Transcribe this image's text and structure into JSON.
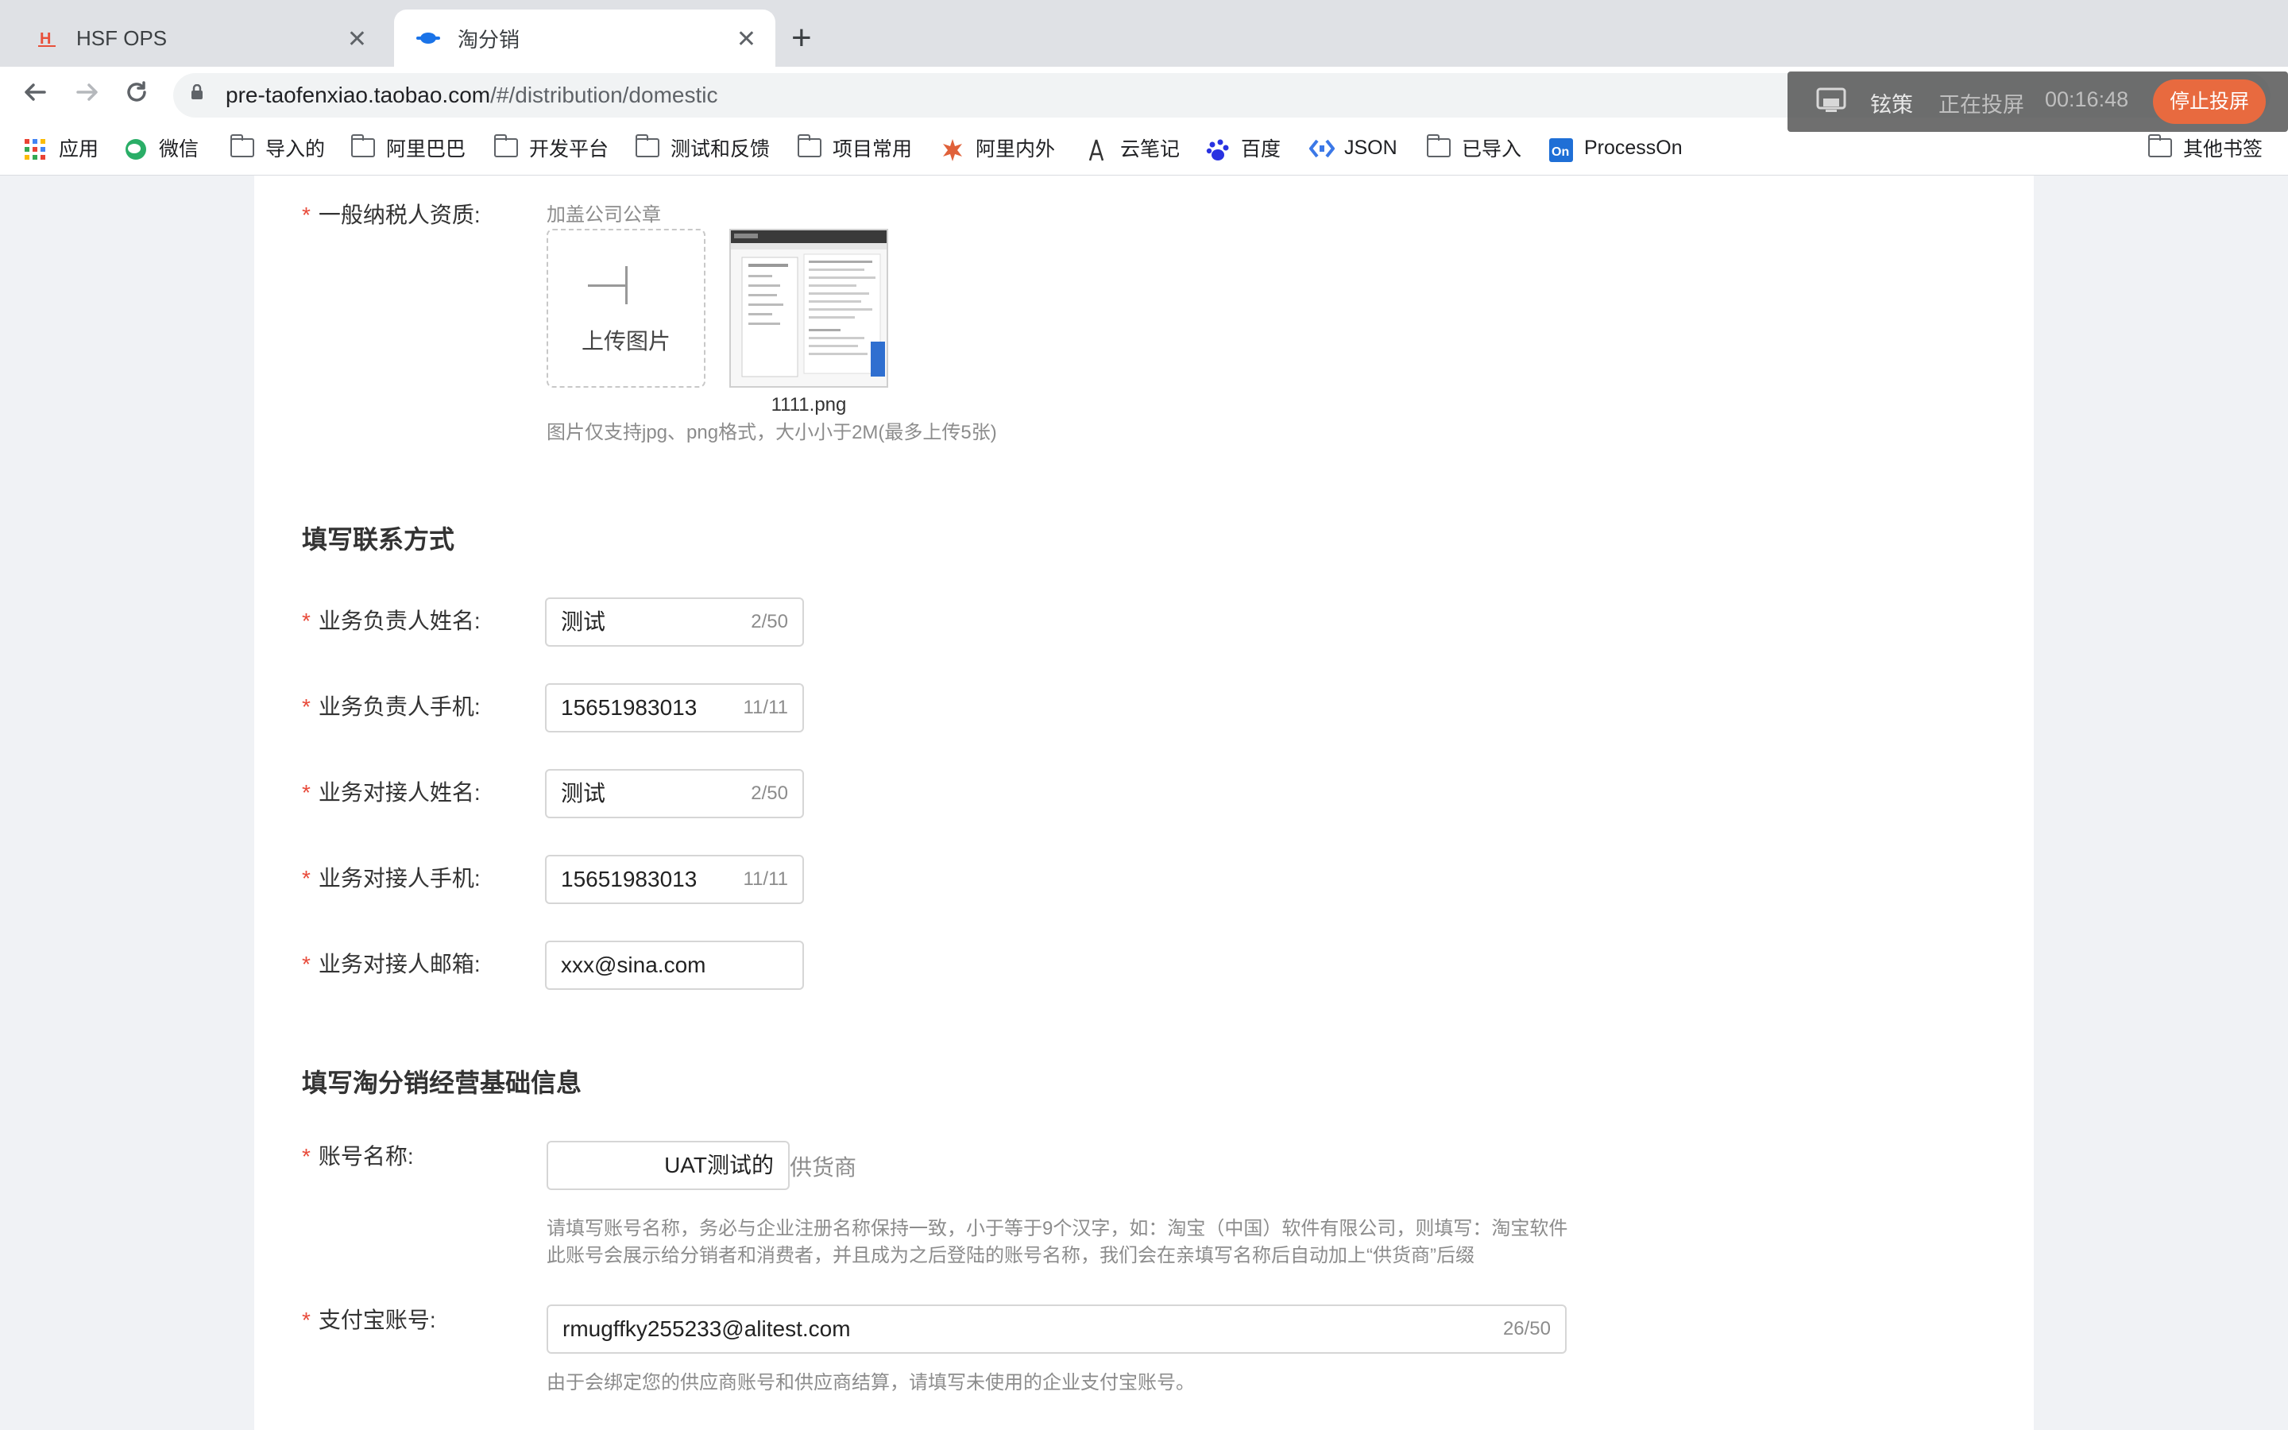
{
  "browser": {
    "tabs": [
      {
        "title": "HSF OPS",
        "active": false
      },
      {
        "title": "淘分销",
        "active": true
      }
    ],
    "url_host": "pre-taofenxiao.taobao.com",
    "url_path": "/#/distribution/domestic",
    "bookmarks": [
      {
        "label": "应用",
        "icon": "apps-grid-icon"
      },
      {
        "label": "微信",
        "icon": "wechat-icon"
      },
      {
        "label": "导入的",
        "icon": "folder-icon"
      },
      {
        "label": "阿里巴巴",
        "icon": "folder-icon"
      },
      {
        "label": "开发平台",
        "icon": "folder-icon"
      },
      {
        "label": "测试和反馈",
        "icon": "folder-icon"
      },
      {
        "label": "项目常用",
        "icon": "folder-icon"
      },
      {
        "label": "阿里内外",
        "icon": "alibaba-icon"
      },
      {
        "label": "云笔记",
        "icon": "pen-icon"
      },
      {
        "label": "百度",
        "icon": "baidu-icon"
      },
      {
        "label": "JSON",
        "icon": "json-icon"
      },
      {
        "label": "已导入",
        "icon": "folder-icon"
      },
      {
        "label": "ProcessOn",
        "icon": "processon-icon"
      },
      {
        "label": "其他书签",
        "icon": "folder-icon"
      }
    ]
  },
  "screen_share": {
    "name": "铉策",
    "status": "正在投屏",
    "time": "00:16:48",
    "stop_label": "停止投屏"
  },
  "taxpayer": {
    "label": "一般纳税人资质:",
    "note": "加盖公司公章",
    "upload_label": "上传图片",
    "file_name": "1111.png",
    "hint": "图片仅支持jpg、png格式，大小小于2M(最多上传5张)"
  },
  "contact": {
    "title": "填写联系方式",
    "fields": [
      {
        "label": "业务负责人姓名:",
        "value": "测试",
        "count": "2/50"
      },
      {
        "label": "业务负责人手机:",
        "value": "15651983013",
        "count": "11/11"
      },
      {
        "label": "业务对接人姓名:",
        "value": "测试",
        "count": "2/50"
      },
      {
        "label": "业务对接人手机:",
        "value": "15651983013",
        "count": "11/11"
      },
      {
        "label": "业务对接人邮箱:",
        "value": "xxx@sina.com",
        "count": ""
      }
    ]
  },
  "basic": {
    "title": "填写淘分销经营基础信息",
    "account_label": "账号名称:",
    "account_value": "UAT测试的",
    "account_suffix": "供货商",
    "account_hint1": "请填写账号名称，务必与企业注册名称保持一致，小于等于9个汉字，如：淘宝（中国）软件有限公司，则填写：淘宝软件",
    "account_hint2": "此账号会展示给分销者和消费者，并且成为之后登陆的账号名称，我们会在亲填写名称后自动加上“供货商”后缀",
    "alipay_label": "支付宝账号:",
    "alipay_value": "rmugffky255233@alitest.com",
    "alipay_count": "26/50",
    "alipay_hint": "由于会绑定您的供应商账号和供应商结算，请填写未使用的企业支付宝账号。"
  }
}
